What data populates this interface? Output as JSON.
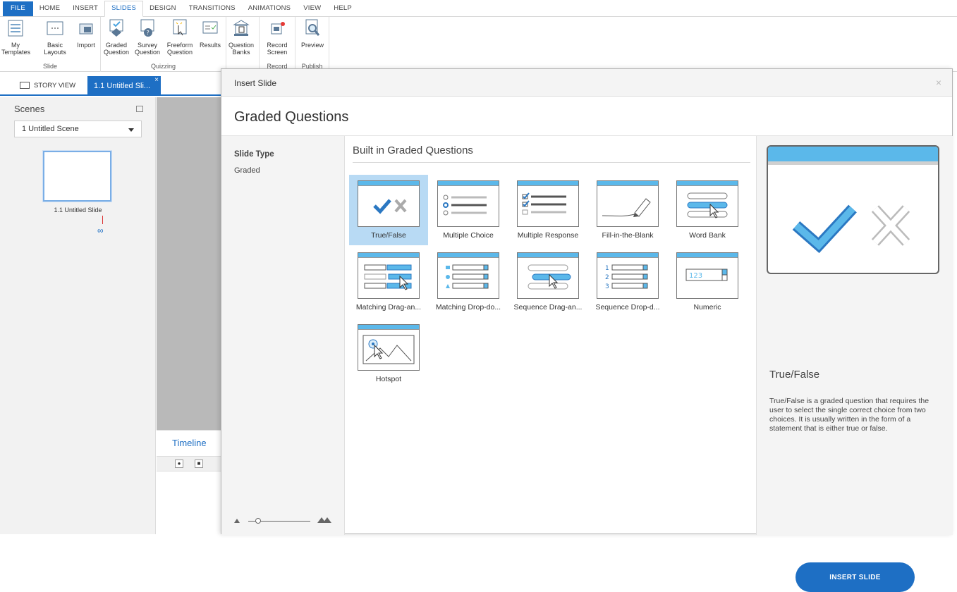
{
  "ribbon_tabs": [
    "FILE",
    "HOME",
    "INSERT",
    "SLIDES",
    "DESIGN",
    "TRANSITIONS",
    "ANIMATIONS",
    "VIEW",
    "HELP"
  ],
  "ribbon": {
    "slide_group": {
      "label": "Slide",
      "my_templates": "My Templates",
      "basic_layouts": "Basic Layouts",
      "import": "Import"
    },
    "quizzing_group": {
      "label": "Quizzing",
      "graded": "Graded Question",
      "survey": "Survey Question",
      "freeform": "Freeform Question",
      "results": "Results",
      "banks": "Question Banks"
    },
    "record_group": {
      "label": "Record",
      "record_screen": "Record Screen"
    },
    "publish_group": {
      "label": "Publish",
      "preview": "Preview"
    }
  },
  "view_tabs": {
    "story": "STORY VIEW",
    "slide": "1.1 Untitled Sli...",
    "close": "×"
  },
  "scenes": {
    "title": "Scenes",
    "selected_scene": "1 Untitled Scene",
    "thumb_label": "1.1 Untitled Slide"
  },
  "timeline": {
    "title": "Timeline"
  },
  "dialog": {
    "title": "Insert Slide",
    "close": "×",
    "heading": "Graded Questions",
    "slide_type_label": "Slide Type",
    "slide_type_item": "Graded",
    "gallery_title": "Built in Graded Questions",
    "tiles": [
      {
        "label": "True/False",
        "icon": "true-false-icon"
      },
      {
        "label": "Multiple Choice",
        "icon": "multiple-choice-icon"
      },
      {
        "label": "Multiple Response",
        "icon": "multiple-response-icon"
      },
      {
        "label": "Fill-in-the-Blank",
        "icon": "fill-in-blank-icon"
      },
      {
        "label": "Word Bank",
        "icon": "word-bank-icon"
      },
      {
        "label": "Matching  Drag-an...",
        "icon": "matching-drag-icon"
      },
      {
        "label": "Matching  Drop-do...",
        "icon": "matching-dropdown-icon"
      },
      {
        "label": "Sequence  Drag-an...",
        "icon": "sequence-drag-icon"
      },
      {
        "label": "Sequence  Drop-d...",
        "icon": "sequence-dropdown-icon"
      },
      {
        "label": "Numeric",
        "icon": "numeric-icon",
        "value": "123"
      },
      {
        "label": "Hotspot",
        "icon": "hotspot-icon"
      }
    ],
    "sequence_numbers": [
      "1",
      "2",
      "3"
    ],
    "preview_name": "True/False",
    "preview_description": "True/False is a graded question that requires the user to select the single correct choice from two choices.  It is usually written in the form of a statement that is either true or false.",
    "insert_button": "INSERT SLIDE"
  },
  "colors": {
    "accent": "#1e6fc4",
    "tile_bar": "#5bb8ea",
    "selected_tile": "#b8daf4"
  }
}
